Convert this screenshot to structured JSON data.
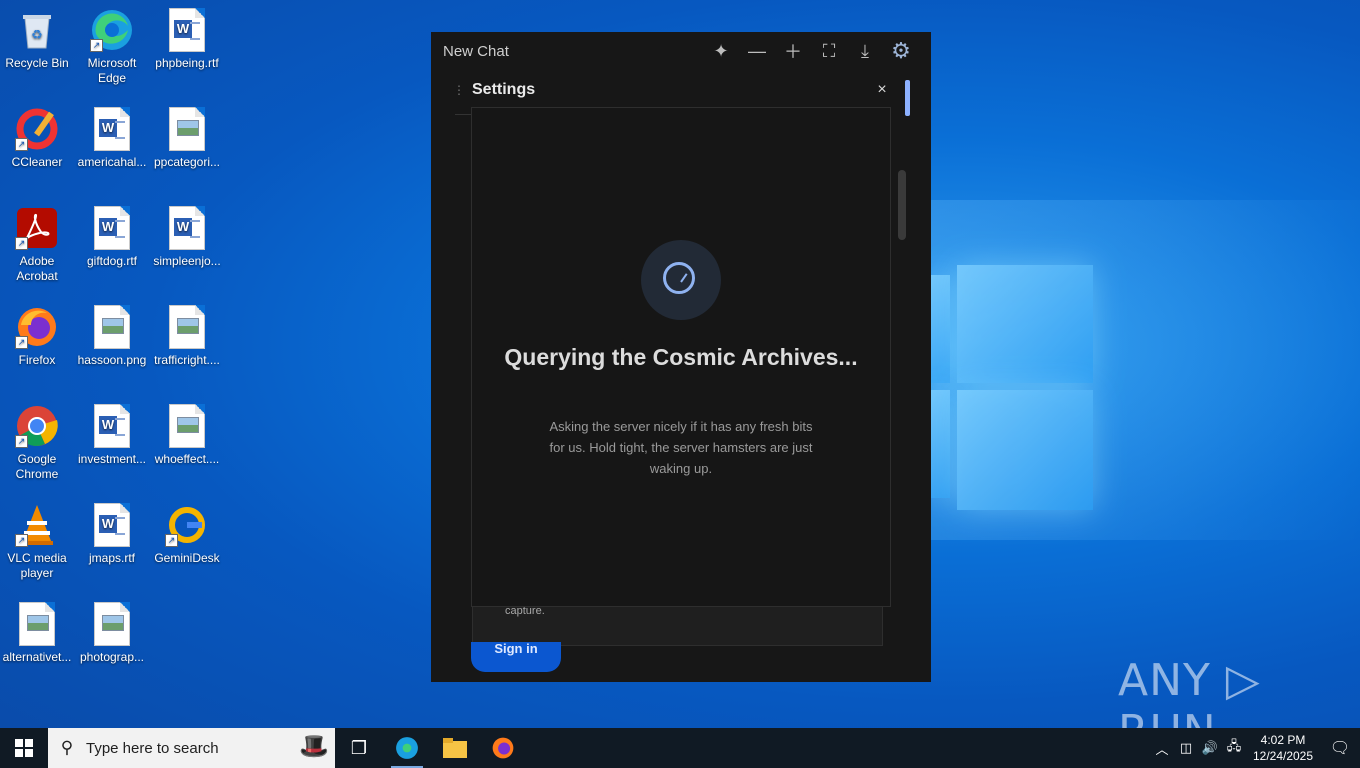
{
  "desktop": {
    "icons": [
      {
        "label": "Recycle Bin",
        "icon": "recycle-bin-icon"
      },
      {
        "label": "Microsoft Edge",
        "icon": "edge-icon"
      },
      {
        "label": "phpbeing.rtf",
        "icon": "word-doc-icon"
      },
      {
        "label": "CCleaner",
        "icon": "ccleaner-icon"
      },
      {
        "label": "americahal...",
        "icon": "word-doc-icon"
      },
      {
        "label": "ppcategori...",
        "icon": "image-file-icon"
      },
      {
        "label": "Adobe Acrobat",
        "icon": "acrobat-icon"
      },
      {
        "label": "giftdog.rtf",
        "icon": "word-doc-icon"
      },
      {
        "label": "simpleenjo...",
        "icon": "word-doc-icon"
      },
      {
        "label": "Firefox",
        "icon": "firefox-icon"
      },
      {
        "label": "hassoon.png",
        "icon": "image-file-icon"
      },
      {
        "label": "trafficright....",
        "icon": "image-file-icon"
      },
      {
        "label": "Google Chrome",
        "icon": "chrome-icon"
      },
      {
        "label": "investment...",
        "icon": "word-doc-icon"
      },
      {
        "label": "whoeffect....",
        "icon": "image-file-icon"
      },
      {
        "label": "VLC media player",
        "icon": "vlc-icon"
      },
      {
        "label": "jmaps.rtf",
        "icon": "word-doc-icon"
      },
      {
        "label": "GeminiDesk",
        "icon": "geminidesk-icon"
      },
      {
        "label": "alternativet...",
        "icon": "image-file-icon"
      },
      {
        "label": "photograp...",
        "icon": "image-file-icon"
      }
    ]
  },
  "app": {
    "title": "New Chat",
    "settings_title": "Settings",
    "close_symbol": "×",
    "loading_title": "Querying the Cosmic Archives...",
    "loading_body": "Asking the server nicely if it has any fresh bits for us. Hold tight, the server hamsters are just waking up.",
    "behind_text": "capture.",
    "signin_label": "Sign in"
  },
  "watermark": "ANY ▷ RUN",
  "taskbar": {
    "search_placeholder": "Type here to search",
    "time": "4:02 PM",
    "date": "12/24/2025"
  }
}
